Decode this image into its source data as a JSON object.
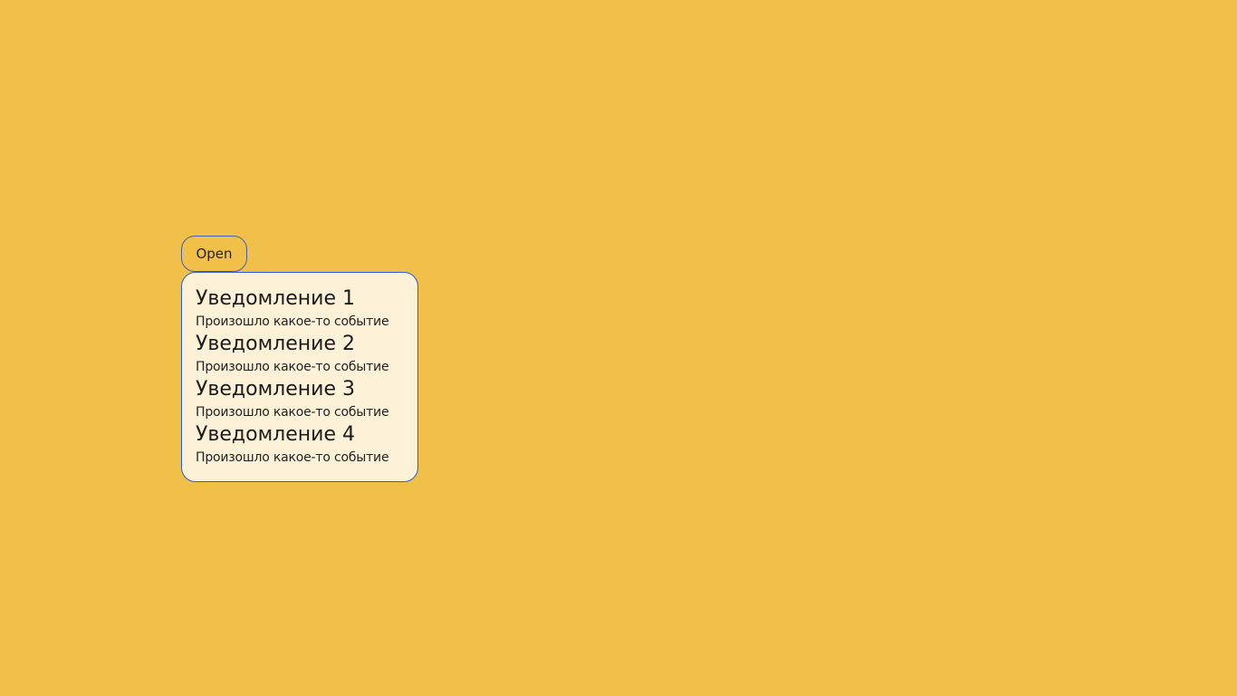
{
  "colors": {
    "background": "#f0c049",
    "popover_background": "#fdf2d8",
    "popover_border": "#2f5fd0",
    "button_border": "#4a5fa8"
  },
  "button": {
    "label": "Open"
  },
  "notifications": [
    {
      "title": "Уведомление 1",
      "text": "Произошло какое-то событие"
    },
    {
      "title": "Уведомление 2",
      "text": "Произошло какое-то событие"
    },
    {
      "title": "Уведомление 3",
      "text": "Произошло какое-то событие"
    },
    {
      "title": "Уведомление 4",
      "text": "Произошло какое-то событие"
    }
  ]
}
